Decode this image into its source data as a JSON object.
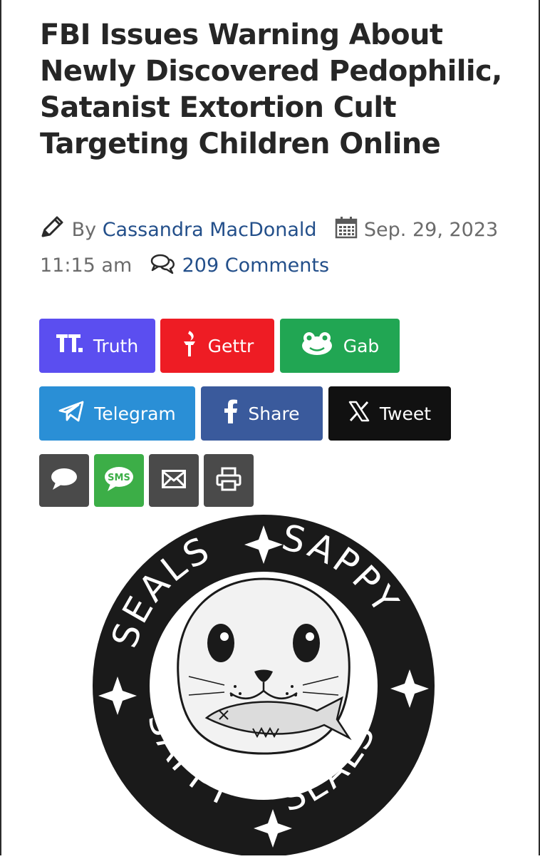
{
  "article": {
    "title": "FBI Issues Warning About Newly Discovered Pedophilic, Satanist Extortion Cult Targeting Children Online"
  },
  "meta": {
    "by_prefix": "By",
    "author": "Cassandra MacDonald",
    "date": "Sep. 29, 2023 11:15 am",
    "comments": "209 Comments"
  },
  "share": {
    "truth": "Truth",
    "gettr": "Gettr",
    "gab": "Gab",
    "telegram": "Telegram",
    "facebook": "Share",
    "x": "Tweet"
  },
  "small_buttons": {
    "sms_text": "SMS"
  },
  "image": {
    "logo_text_top_left": "SEALS",
    "logo_text_top_right": "SAPPY",
    "logo_text_bottom_left": "SAPPY",
    "logo_text_bottom_right": "SEALS"
  },
  "colors": {
    "truth": "#5b4ef0",
    "gettr": "#ee1c24",
    "gab": "#21a653",
    "telegram": "#2a8fd6",
    "facebook": "#3a5a9c",
    "x": "#111111",
    "small_gray": "#4a4a4a",
    "sms": "#3cae47",
    "link": "#234f8a"
  }
}
